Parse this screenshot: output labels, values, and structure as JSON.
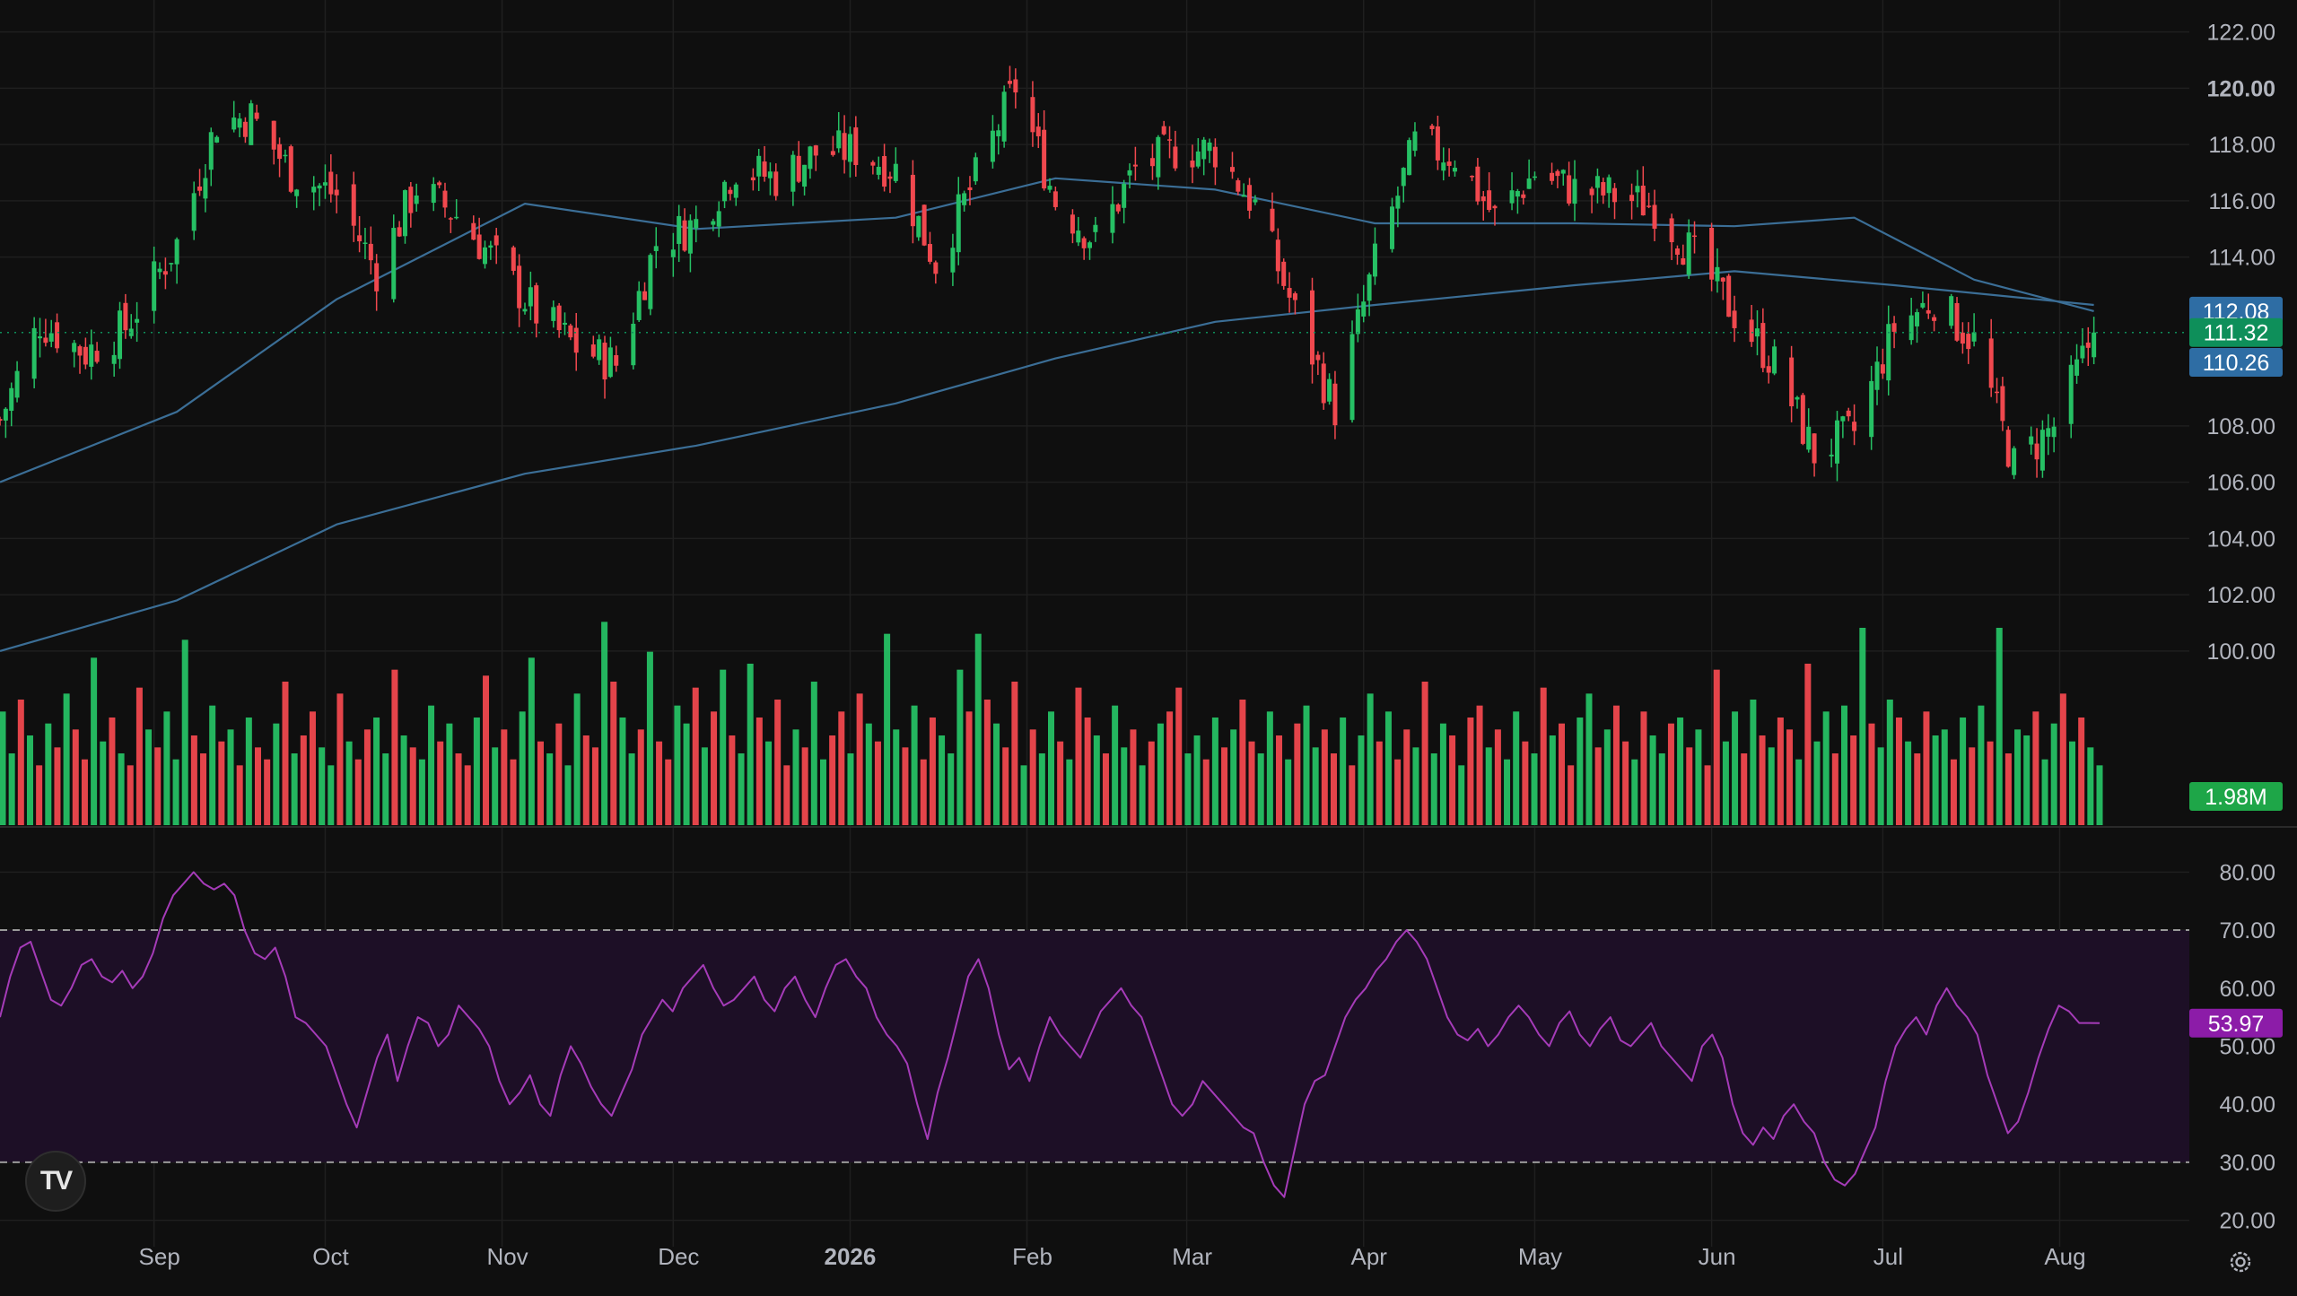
{
  "chart_data": {
    "type": "candlestick",
    "price_axis": {
      "ticks": [
        "122.00",
        "120.00",
        "118.00",
        "116.00",
        "114.00",
        "108.00",
        "106.00",
        "104.00",
        "102.00",
        "100.00"
      ],
      "ylim": [
        97,
        122.5
      ]
    },
    "rsi_axis": {
      "ticks": [
        "80.00",
        "70.00",
        "60.00",
        "50.00",
        "40.00",
        "30.00",
        "20.00"
      ],
      "ylim": [
        17,
        85
      ],
      "band": [
        30,
        70
      ]
    },
    "x_labels": [
      {
        "label": "Sep",
        "date": "2025-09-01"
      },
      {
        "label": "Oct",
        "date": "2025-10-01"
      },
      {
        "label": "Nov",
        "date": "2025-11-01"
      },
      {
        "label": "Dec",
        "date": "2025-12-01"
      },
      {
        "label": "2026",
        "date": "2026-01-01"
      },
      {
        "label": "Feb",
        "date": "2026-02-01"
      },
      {
        "label": "Mar",
        "date": "2026-03-01"
      },
      {
        "label": "Apr",
        "date": "2026-04-01"
      },
      {
        "label": "May",
        "date": "2026-05-01"
      },
      {
        "label": "Jun",
        "date": "2026-06-01"
      },
      {
        "label": "Jul",
        "date": "2026-07-01"
      },
      {
        "label": "Aug",
        "date": "2026-08-01"
      }
    ],
    "x_range": [
      "2025-08-05",
      "2026-08-08"
    ],
    "close_series": {
      "dates": [
        "2025-08-05",
        "2025-08-12",
        "2025-08-20",
        "2025-08-27",
        "2025-09-05",
        "2025-09-12",
        "2025-09-18",
        "2025-09-25",
        "2025-10-03",
        "2025-10-10",
        "2025-10-17",
        "2025-10-24",
        "2025-10-31",
        "2025-11-07",
        "2025-11-14",
        "2025-11-21",
        "2025-11-28",
        "2025-12-05",
        "2025-12-12",
        "2025-12-19",
        "2025-12-26",
        "2026-01-02",
        "2026-01-09",
        "2026-01-16",
        "2026-01-23",
        "2026-01-30",
        "2026-02-06",
        "2026-02-13",
        "2026-02-20",
        "2026-02-27",
        "2026-03-06",
        "2026-03-13",
        "2026-03-20",
        "2026-03-27",
        "2026-04-03",
        "2026-04-10",
        "2026-04-17",
        "2026-04-24",
        "2026-05-01",
        "2026-05-08",
        "2026-05-15",
        "2026-05-22",
        "2026-05-29",
        "2026-06-05",
        "2026-06-12",
        "2026-06-19",
        "2026-06-26",
        "2026-07-03",
        "2026-07-10",
        "2026-07-17",
        "2026-07-24",
        "2026-07-31",
        "2026-08-07"
      ],
      "values": [
        108.2,
        111.7,
        110.6,
        111.5,
        114.5,
        118.8,
        119.0,
        117.0,
        116.2,
        113.5,
        116.5,
        115.5,
        113.8,
        112.0,
        110.8,
        110.2,
        114.5,
        115.2,
        117.2,
        116.8,
        117.7,
        117.8,
        117.1,
        113.8,
        116.8,
        120.1,
        116.0,
        114.6,
        117.1,
        117.8,
        117.8,
        115.8,
        112.0,
        108.6,
        113.8,
        118.0,
        117.6,
        115.4,
        117.0,
        116.4,
        116.2,
        115.8,
        114.0,
        112.0,
        110.2,
        107.0,
        107.8,
        111.5,
        112.5,
        111.0,
        106.6,
        108.0,
        111.32
      ]
    },
    "ma_series": [
      {
        "values_dates": [
          "2025-08-05",
          "2025-09-05",
          "2025-10-03",
          "2025-11-05",
          "2025-12-05",
          "2026-01-09",
          "2026-02-06",
          "2026-03-06",
          "2026-04-03",
          "2026-05-08",
          "2026-06-05",
          "2026-06-26",
          "2026-07-17",
          "2026-08-07"
        ],
        "values": [
          106.0,
          108.5,
          112.5,
          115.9,
          115.0,
          115.4,
          116.8,
          116.4,
          115.2,
          115.2,
          115.1,
          115.4,
          113.2,
          112.08
        ]
      },
      {
        "values_dates": [
          "2025-08-05",
          "2025-09-05",
          "2025-10-03",
          "2025-11-05",
          "2025-12-05",
          "2026-01-09",
          "2026-02-06",
          "2026-03-06",
          "2026-04-03",
          "2026-05-08",
          "2026-06-05",
          "2026-07-03",
          "2026-08-07"
        ],
        "values": [
          100.0,
          101.8,
          104.5,
          106.3,
          107.3,
          108.8,
          110.4,
          111.7,
          112.3,
          113.0,
          113.5,
          113.0,
          112.3
        ]
      }
    ],
    "volume_series": {
      "max": 3.3,
      "values": [
        1.9,
        1.2,
        2.1,
        1.5,
        1.0,
        1.7,
        1.3,
        2.2,
        1.6,
        1.1,
        2.8,
        1.4,
        1.8,
        1.2,
        1.0,
        2.3,
        1.6,
        1.3,
        1.9,
        1.1,
        3.1,
        1.5,
        1.2,
        2.0,
        1.4,
        1.6,
        1.0,
        1.8,
        1.3,
        1.1,
        1.7,
        2.4,
        1.2,
        1.5,
        1.9,
        1.3,
        1.0,
        2.2,
        1.4,
        1.1,
        1.6,
        1.8,
        1.2,
        2.6,
        1.5,
        1.3,
        1.1,
        2.0,
        1.4,
        1.7,
        1.2,
        1.0,
        1.8,
        2.5,
        1.3,
        1.6,
        1.1,
        1.9,
        2.8,
        1.4,
        1.2,
        1.7,
        1.0,
        2.2,
        1.5,
        1.3,
        3.4,
        2.4,
        1.8,
        1.2,
        1.6,
        2.9,
        1.4,
        1.1,
        2.0,
        1.7,
        2.3,
        1.3,
        1.9,
        2.6,
        1.5,
        1.2,
        2.7,
        1.8,
        1.4,
        2.1,
        1.0,
        1.6,
        1.3,
        2.4,
        1.1,
        1.5,
        1.9,
        1.2,
        2.2,
        1.7,
        1.4,
        3.2,
        1.6,
        1.3,
        2.0,
        1.1,
        1.8,
        1.5,
        1.2,
        2.6,
        1.9,
        3.2,
        2.1,
        1.7,
        1.3,
        2.4,
        1.0,
        1.6,
        1.2,
        1.9,
        1.4,
        1.1,
        2.3,
        1.8,
        1.5,
        1.2,
        2.0,
        1.3,
        1.6,
        1.0,
        1.4,
        1.7,
        1.9,
        2.3,
        1.2,
        1.5,
        1.1,
        1.8,
        1.3,
        1.6,
        2.1,
        1.4,
        1.2,
        1.9,
        1.5,
        1.1,
        1.7,
        2.0,
        1.3,
        1.6,
        1.2,
        1.8,
        1.0,
        1.5,
        2.2,
        1.4,
        1.9,
        1.1,
        1.6,
        1.3,
        2.4,
        1.2,
        1.7,
        1.5,
        1.0,
        1.8,
        2.0,
        1.3,
        1.6,
        1.1,
        1.9,
        1.4,
        1.2,
        2.3,
        1.5,
        1.7,
        1.0,
        1.8,
        2.2,
        1.3,
        1.6,
        2.0,
        1.4,
        1.1,
        1.9,
        1.5,
        1.2,
        1.7,
        1.8,
        1.3,
        1.6,
        1.0,
        2.6,
        1.4,
        1.9,
        1.2,
        2.1,
        1.5,
        1.3,
        1.8,
        1.6,
        1.1,
        2.7,
        1.4,
        1.9,
        1.2,
        2.0,
        1.5,
        3.3,
        1.7,
        1.3,
        2.1,
        1.8,
        1.4,
        1.2,
        1.9,
        1.5,
        1.6,
        1.1,
        1.8,
        1.3,
        2.0,
        1.4,
        3.3,
        1.2,
        1.6,
        1.5,
        1.9,
        1.1,
        1.7,
        2.2,
        1.4,
        1.8,
        1.3,
        1.0
      ],
      "up_flags": [
        1,
        1,
        0,
        1,
        0,
        1,
        0,
        1,
        0,
        0,
        1,
        1,
        0,
        1,
        0,
        0,
        1,
        0,
        1,
        1,
        1,
        0,
        0,
        1,
        0,
        1,
        0,
        1,
        0,
        0,
        1,
        0,
        1,
        0,
        0,
        1,
        1,
        0,
        1,
        0,
        0,
        1,
        1,
        0,
        1,
        0,
        1,
        1,
        0,
        1,
        0,
        0,
        1,
        0,
        1,
        0,
        0,
        1,
        1,
        0,
        1,
        0,
        1,
        1,
        0,
        0,
        1,
        0,
        1,
        1,
        0,
        1,
        0,
        0,
        1,
        1,
        0,
        1,
        0,
        1,
        0,
        1,
        1,
        0,
        1,
        0,
        0,
        1,
        0,
        1,
        1,
        0,
        0,
        1,
        0,
        1,
        0,
        1,
        1,
        0,
        1,
        0,
        0,
        1,
        1,
        1,
        0,
        1,
        0,
        1,
        0,
        0,
        1,
        0,
        1,
        1,
        0,
        1,
        0,
        0,
        1,
        0,
        1,
        1,
        0,
        1,
        0,
        1,
        0,
        0,
        1,
        1,
        0,
        1,
        0,
        1,
        0,
        0,
        1,
        1,
        0,
        1,
        0,
        1,
        1,
        0,
        0,
        1,
        0,
        1,
        1,
        0,
        1,
        0,
        0,
        1,
        0,
        1,
        1,
        0,
        1,
        0,
        0,
        1,
        0,
        1,
        1,
        0,
        1,
        0,
        1,
        0,
        0,
        1,
        1,
        0,
        1,
        0,
        0,
        1,
        0,
        1,
        1,
        0,
        1,
        0,
        1,
        0,
        0,
        1,
        1,
        0,
        1,
        0,
        1,
        0,
        0,
        1,
        0,
        1,
        1,
        0,
        1,
        0,
        1,
        0,
        1,
        1,
        0,
        1,
        0,
        0,
        1,
        1,
        0,
        1,
        0,
        1,
        0,
        1,
        0,
        1,
        1,
        0,
        1,
        1,
        0,
        1,
        0,
        1
      ]
    },
    "rsi_series": {
      "values": [
        55,
        62,
        67,
        68,
        63,
        58,
        57,
        60,
        64,
        65,
        62,
        61,
        63,
        60,
        62,
        66,
        72,
        76,
        78,
        80,
        78,
        77,
        78,
        76,
        70,
        66,
        65,
        67,
        62,
        55,
        54,
        52,
        50,
        45,
        40,
        36,
        42,
        48,
        52,
        44,
        50,
        55,
        54,
        50,
        52,
        57,
        55,
        53,
        50,
        44,
        40,
        42,
        45,
        40,
        38,
        45,
        50,
        47,
        43,
        40,
        38,
        42,
        46,
        52,
        55,
        58,
        56,
        60,
        62,
        64,
        60,
        57,
        58,
        60,
        62,
        58,
        56,
        60,
        62,
        58,
        55,
        60,
        64,
        65,
        62,
        60,
        55,
        52,
        50,
        47,
        40,
        34,
        42,
        48,
        55,
        62,
        65,
        60,
        52,
        46,
        48,
        44,
        50,
        55,
        52,
        50,
        48,
        52,
        56,
        58,
        60,
        57,
        55,
        50,
        45,
        40,
        38,
        40,
        44,
        42,
        40,
        38,
        36,
        35,
        30,
        26,
        24,
        32,
        40,
        44,
        45,
        50,
        55,
        58,
        60,
        63,
        65,
        68,
        70,
        68,
        65,
        60,
        55,
        52,
        51,
        53,
        50,
        52,
        55,
        57,
        55,
        52,
        50,
        54,
        56,
        52,
        50,
        53,
        55,
        51,
        50,
        52,
        54,
        50,
        48,
        46,
        44,
        50,
        52,
        48,
        40,
        35,
        33,
        36,
        34,
        38,
        40,
        37,
        35,
        30,
        27,
        26,
        28,
        32,
        36,
        44,
        50,
        53,
        55,
        52,
        57,
        60,
        57,
        55,
        52,
        45,
        40,
        35,
        37,
        42,
        48,
        53,
        57,
        56,
        54,
        54,
        53.97
      ]
    },
    "last_labels": {
      "ma_upper": "112.08",
      "last_price": "111.32",
      "ma_lower": "110.26",
      "volume": "1.98M",
      "rsi": "53.97"
    },
    "colors": {
      "up": "#26c064",
      "down": "#f0484e",
      "ma": "#3b6e96",
      "ma_label": "#2e6da4",
      "price_label": "#0e8f5a",
      "rsi_line": "#a53bb8",
      "rsi_band": "#1d0f26",
      "rsi_label": "#8c1ca8",
      "volume_label": "#1ea648"
    }
  },
  "logo": {
    "glyph": "TV"
  }
}
